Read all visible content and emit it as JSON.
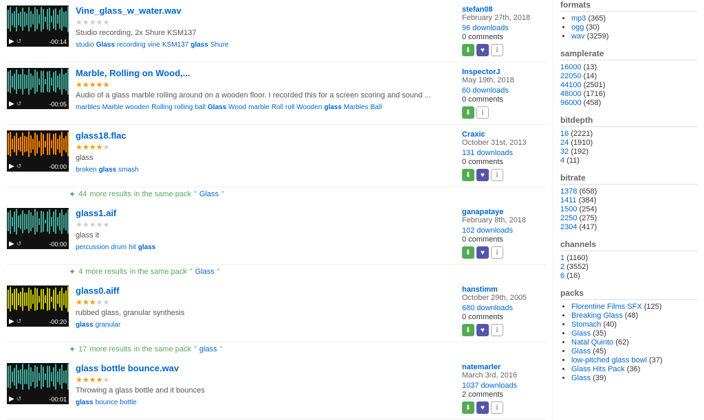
{
  "sounds": [
    {
      "id": "vine_glass_w_water",
      "title": "Vine_glass_w_water.wav",
      "description": "Studio recording, 2x Shure KSM137",
      "tags": [
        "studio",
        "Glass",
        "recording",
        "vine",
        "KSM137",
        "glass",
        "Shure"
      ],
      "boldTags": [
        "Glass",
        "glass"
      ],
      "author": "stefan08",
      "date": "February 27th, 2018",
      "downloads": "96 downloads",
      "comments": "0 comments",
      "time": "-00:14",
      "stars": 0,
      "waveformColor": "green",
      "actions": [
        "download",
        "bookmark",
        "info"
      ]
    },
    {
      "id": "marble_rolling_on_wood",
      "title": "Marble, Rolling on Wood,...",
      "description": "Audio of a glass marble rolling around on a wooden floor. I recorded this for a screen scoring and sound ...",
      "tags": [
        "marbles",
        "Marble",
        "wooden",
        "Rolling",
        "rolling",
        "ball",
        "Glass",
        "Wood",
        "marble",
        "Roll",
        "roll",
        "Wooden",
        "glass",
        "Marbles",
        "Ball"
      ],
      "boldTags": [
        "glass",
        "Glass"
      ],
      "author": "InspectorJ",
      "date": "May 19th, 2018",
      "downloads": "60 downloads",
      "comments": "0 comments",
      "time": "-00:05",
      "stars": 5,
      "waveformColor": "green",
      "actions": [
        "download",
        "info"
      ]
    },
    {
      "id": "glass18_flac",
      "title": "glass18.flac",
      "description": "glass",
      "tags": [
        "broken",
        "glass",
        "smash"
      ],
      "boldTags": [
        "glass"
      ],
      "author": "Craxic",
      "date": "October 31st, 2013",
      "downloads": "131 downloads",
      "comments": "0 comments",
      "time": "-00:00",
      "stars": 4,
      "waveformColor": "orange",
      "actions": [
        "download",
        "bookmark",
        "info"
      ]
    },
    {
      "id": "glass1_aif",
      "title": "glass1.aif",
      "description": "glass it",
      "tags": [
        "percussion",
        "drum",
        "hit",
        "glass"
      ],
      "boldTags": [
        "glass"
      ],
      "author": "ganapataye",
      "date": "February 8th, 2018",
      "downloads": "102 downloads",
      "comments": "0 comments",
      "time": "-00:00",
      "stars": 0,
      "waveformColor": "green",
      "actions": [
        "download",
        "bookmark",
        "info"
      ]
    },
    {
      "id": "glass0_aiff",
      "title": "glass0.aiff",
      "description": "rubbed glass, granular synthesis",
      "tags": [
        "glass",
        "granular"
      ],
      "boldTags": [
        "glass"
      ],
      "author": "hanstimm",
      "date": "October 29th, 2005",
      "downloads": "680 downloads",
      "comments": "0 comments",
      "time": "-00:20",
      "stars": 3,
      "waveformColor": "yellow",
      "actions": [
        "download",
        "bookmark",
        "info"
      ]
    },
    {
      "id": "glass_bottle_bounce_wav",
      "title": "glass bottle bounce.wav",
      "description": "Throwing a glass bottle and it bounces",
      "tags": [
        "glass",
        "bounce",
        "bottle"
      ],
      "boldTags": [
        "glass"
      ],
      "author": "natemarler",
      "date": "March 3rd, 2016",
      "downloads": "1037 downloads",
      "comments": "2 comments",
      "time": "-00:01",
      "stars": 4,
      "waveformColor": "green",
      "actions": [
        "download",
        "bookmark",
        "info"
      ]
    }
  ],
  "packResults": [
    {
      "beforeId": "glass1_aif",
      "count": "44",
      "text": "more results",
      "packName": "Glass",
      "inText": "in the same pack"
    },
    {
      "beforeId": "glass0_aiff",
      "count": "4",
      "text": "more results",
      "packName": "Glass",
      "inText": "in the same pack"
    },
    {
      "beforeId": "glass_bottle_bounce_wav",
      "count": "17",
      "text": "more results",
      "packName": "glass",
      "inText": "in the same pack"
    }
  ],
  "sidebar": {
    "formats": {
      "title": "formats",
      "items": [
        {
          "label": "mp3",
          "count": "(365)"
        },
        {
          "label": "ogg",
          "count": "(30)"
        },
        {
          "label": "wav",
          "count": "(3259)"
        }
      ]
    },
    "samplerate": {
      "title": "samplerate",
      "items": [
        {
          "label": "16000",
          "count": "(13)"
        },
        {
          "label": "22050",
          "count": "(14)"
        },
        {
          "label": "44100",
          "count": "(2501)"
        },
        {
          "label": "48000",
          "count": "(1716)"
        },
        {
          "label": "96000",
          "count": "(458)"
        }
      ]
    },
    "bitdepth": {
      "title": "bitdepth",
      "items": [
        {
          "label": "16",
          "count": "(2221)"
        },
        {
          "label": "24",
          "count": "(1910)"
        },
        {
          "label": "32",
          "count": "(192)"
        },
        {
          "label": "4",
          "count": "(11)"
        }
      ]
    },
    "bitrate": {
      "title": "bitrate",
      "items": [
        {
          "label": "1378",
          "count": "(658)"
        },
        {
          "label": "1411",
          "count": "(384)"
        },
        {
          "label": "1500",
          "count": "(254)"
        },
        {
          "label": "2250",
          "count": "(275)"
        },
        {
          "label": "2304",
          "count": "(417)"
        }
      ]
    },
    "channels": {
      "title": "channels",
      "items": [
        {
          "label": "1",
          "count": "(1160)"
        },
        {
          "label": "2",
          "count": "(3552)"
        },
        {
          "label": "6",
          "count": "(16)"
        }
      ]
    },
    "packs": {
      "title": "packs",
      "items": [
        {
          "label": "Florentine Films SFX",
          "count": "(125)"
        },
        {
          "label": "Breaking Glass",
          "count": "(48)"
        },
        {
          "label": "Stomach",
          "count": "(40)"
        },
        {
          "label": "Glass",
          "count": "(35)"
        },
        {
          "label": "Natal Quinto",
          "count": "(62)"
        },
        {
          "label": "Glass",
          "count": "(45)"
        },
        {
          "label": "low-pitched glass bowl",
          "count": "(37)"
        },
        {
          "label": "Glass Hits Pack",
          "count": "(36)"
        },
        {
          "label": "Glass",
          "count": "(39)"
        }
      ]
    }
  }
}
